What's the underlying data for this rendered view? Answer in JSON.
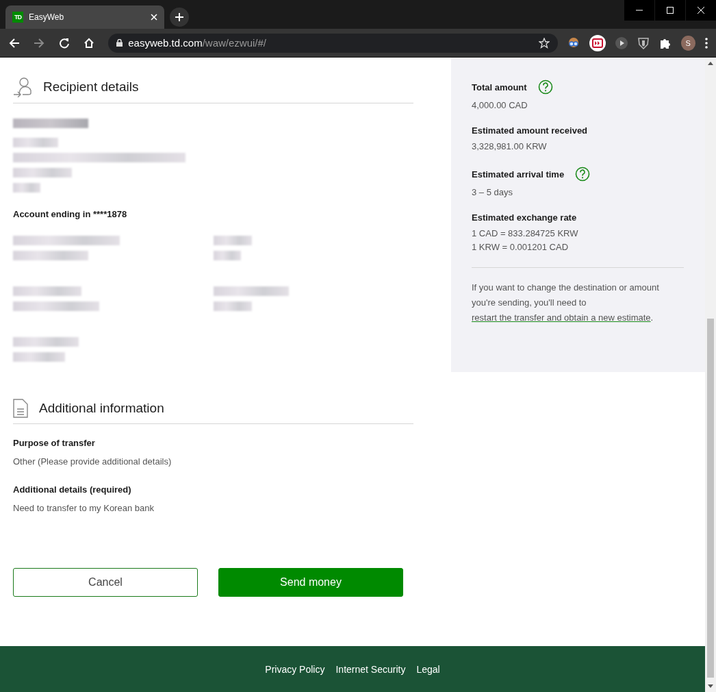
{
  "browser": {
    "tab": {
      "favicon": "TD",
      "title": "EasyWeb"
    },
    "url": {
      "host": "easyweb.td.com",
      "path": "/waw/ezwui/#/"
    },
    "profile_initial": "S"
  },
  "recipient": {
    "title": "Recipient details",
    "account_label": "Account ending in ****1878"
  },
  "additional": {
    "title": "Additional information",
    "fields": [
      {
        "label": "Purpose of transfer",
        "value": "Other (Please provide additional details)"
      },
      {
        "label": "Additional details (required)",
        "value": "Need to transfer to my Korean bank"
      }
    ]
  },
  "buttons": [
    {
      "kind": "secondary",
      "label": "Cancel"
    },
    {
      "kind": "primary",
      "label": "Send money"
    }
  ],
  "summary": {
    "items": [
      {
        "label": "Total amount",
        "help": true,
        "values": [
          "4,000.00 CAD"
        ]
      },
      {
        "label": "Estimated amount received",
        "help": false,
        "values": [
          "3,328,981.00 KRW"
        ]
      },
      {
        "label": "Estimated arrival time",
        "help": true,
        "values": [
          "3 – 5 days"
        ]
      },
      {
        "label": "Estimated exchange rate",
        "help": false,
        "values": [
          "1 CAD = 833.284725 KRW",
          "1 KRW = 0.001201 CAD"
        ]
      }
    ],
    "note": {
      "text": "If you want to change the destination or amount you're sending, you'll need to",
      "link": "restart the transfer and obtain a new estimate",
      "after": "."
    }
  },
  "footer": {
    "links": [
      "Privacy Policy",
      "Internet Security",
      "Legal"
    ]
  }
}
